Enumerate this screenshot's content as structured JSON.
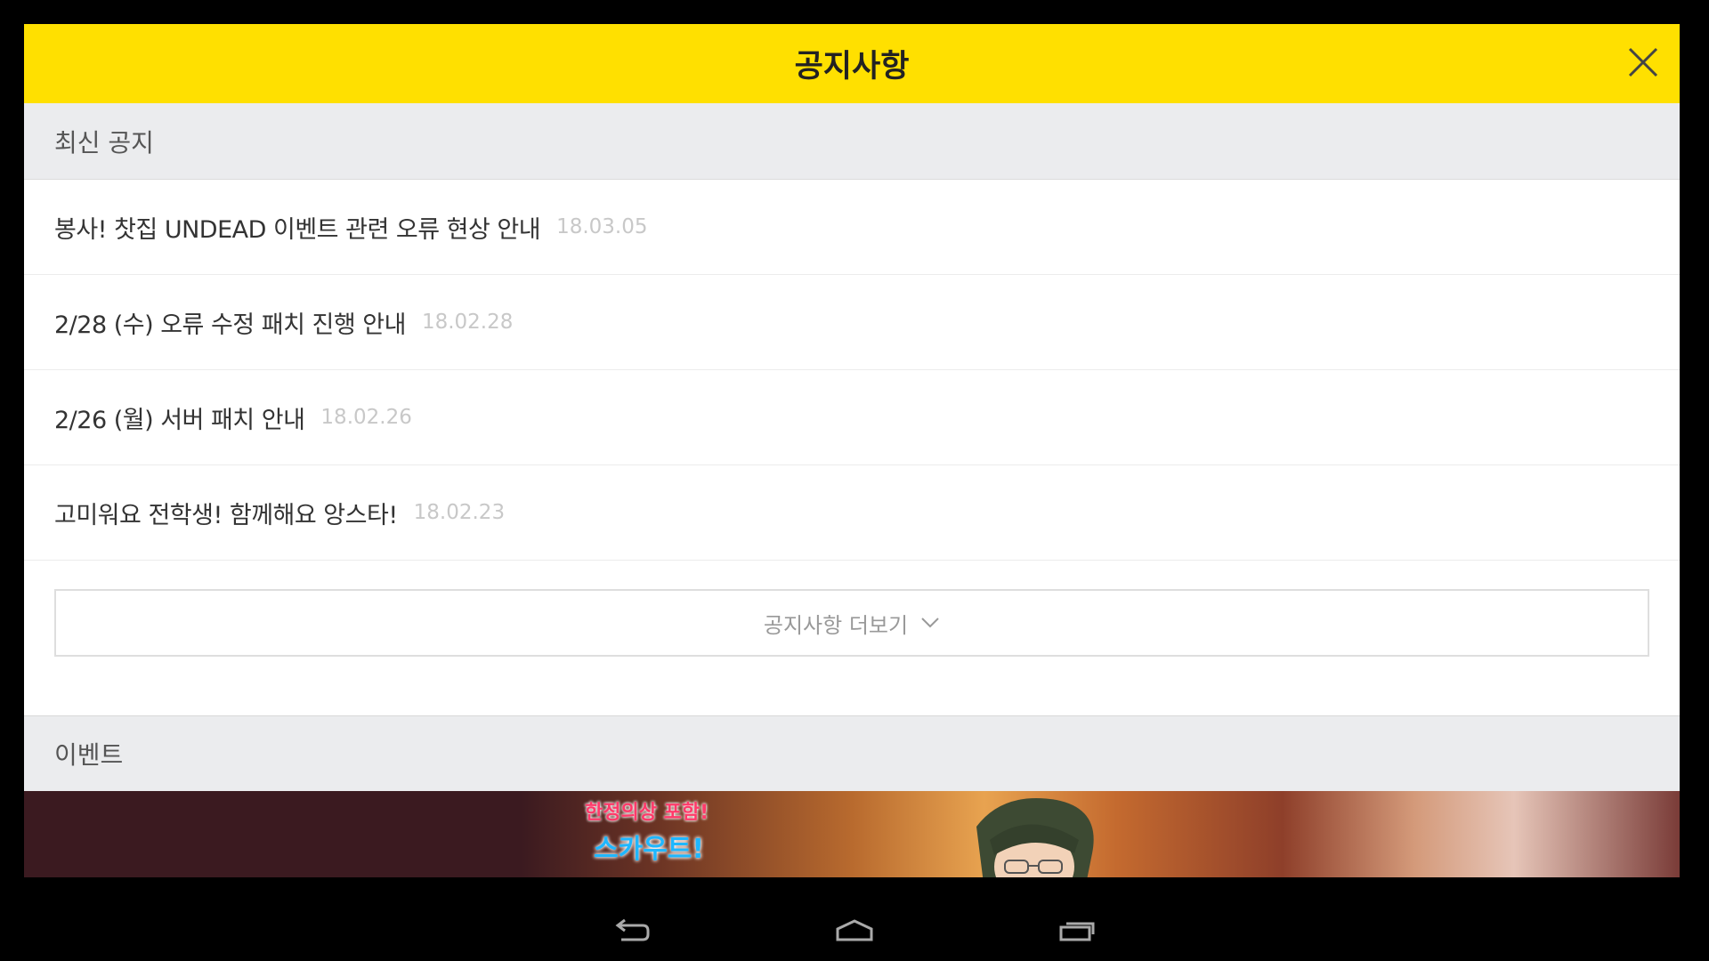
{
  "header": {
    "title": "공지사항"
  },
  "notices": {
    "section_label": "최신 공지",
    "items": [
      {
        "title": "봉사! 찻집 UNDEAD 이벤트 관련 오류 현상 안내",
        "date": "18.03.05"
      },
      {
        "title": "2/28 (수) 오류 수정 패치 진행 안내",
        "date": "18.02.28"
      },
      {
        "title": "2/26 (월) 서버 패치 안내",
        "date": "18.02.26"
      },
      {
        "title": "고미워요 전학생! 함께해요 앙스타!",
        "date": "18.02.23"
      }
    ],
    "more_label": "공지사항 더보기"
  },
  "events": {
    "section_label": "이벤트",
    "banner_tag": "한정의상 포함!",
    "banner_text": "스카우트!"
  },
  "colors": {
    "accent": "#ffe000",
    "section_bg": "#ebecee"
  }
}
